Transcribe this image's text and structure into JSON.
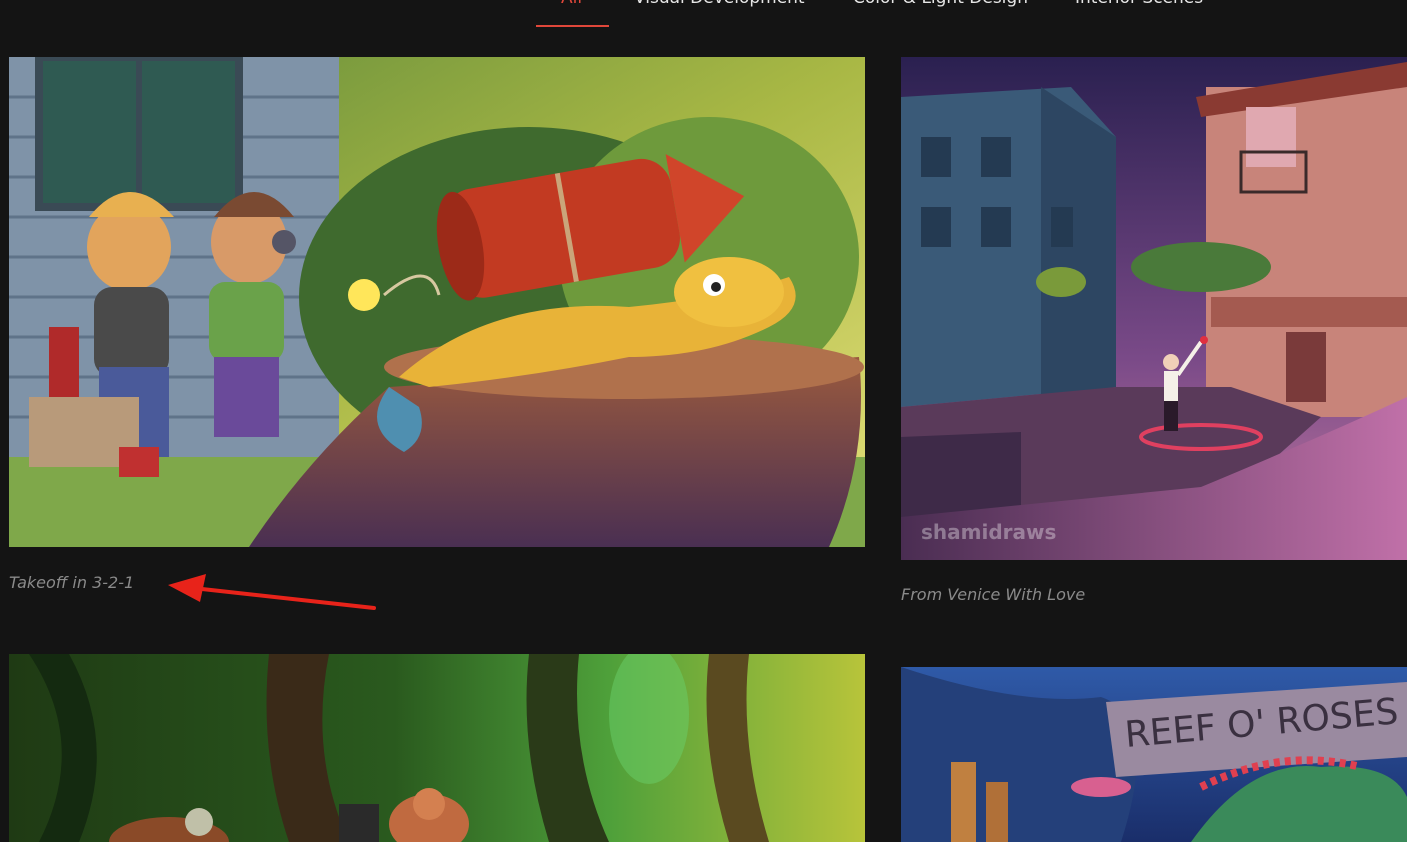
{
  "filter_tabs": [
    {
      "label": "All",
      "active": true
    },
    {
      "label": "Visual Development",
      "active": false
    },
    {
      "label": "Color & Light Design",
      "active": false
    },
    {
      "label": "Interior Scenes",
      "active": false
    }
  ],
  "gallery": {
    "items": [
      {
        "caption": "Takeoff in 3-2-1"
      },
      {
        "caption": "From Venice With Love",
        "watermark": "shamidraws"
      },
      {
        "caption": ""
      },
      {
        "caption": "",
        "sign_text": "REEF O' ROSES"
      }
    ]
  },
  "annotation": {
    "type": "red-arrow",
    "color": "#e8231a",
    "points_to": "Takeoff in 3-2-1"
  },
  "colors": {
    "background": "#141414",
    "accent": "#e0473a",
    "caption": "#8a8a8a",
    "tab_text": "#e6e6e6"
  }
}
